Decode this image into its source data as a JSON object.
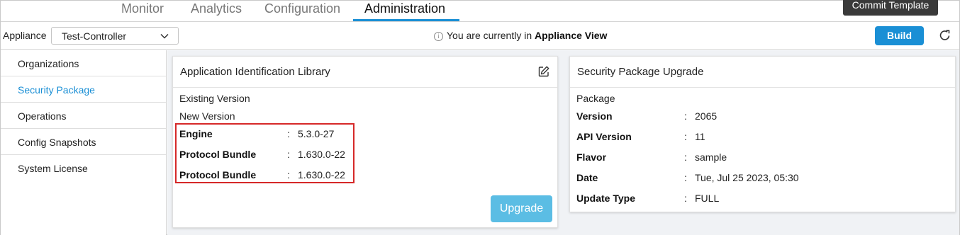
{
  "nav": {
    "tabs": [
      {
        "label": "Monitor"
      },
      {
        "label": "Analytics"
      },
      {
        "label": "Configuration"
      },
      {
        "label": "Administration"
      }
    ],
    "commit_label": "Commit Template"
  },
  "appliance_bar": {
    "label": "Appliance",
    "selected": "Test-Controller",
    "info_prefix": "You are currently in",
    "info_view": "Appliance View",
    "build_label": "Build"
  },
  "sidebar": {
    "items": [
      {
        "label": "Organizations"
      },
      {
        "label": "Security Package"
      },
      {
        "label": "Operations"
      },
      {
        "label": "Config Snapshots"
      },
      {
        "label": "System License"
      }
    ]
  },
  "app_id_card": {
    "title": "Application Identification Library",
    "existing_version_label": "Existing Version",
    "new_version_label": "New Version",
    "rows": [
      {
        "label": "Engine",
        "colon": ":",
        "value": "5.3.0-27"
      },
      {
        "label": "Protocol Bundle",
        "colon": ":",
        "value": "1.630.0-22"
      },
      {
        "label": "Protocol Bundle",
        "colon": ":",
        "value": "1.630.0-22"
      }
    ],
    "upgrade_label": "Upgrade"
  },
  "security_card": {
    "title": "Security Package Upgrade",
    "package_label": "Package",
    "rows": [
      {
        "label": "Version",
        "colon": ":",
        "value": "2065"
      },
      {
        "label": "API Version",
        "colon": ":",
        "value": "11"
      },
      {
        "label": "Flavor",
        "colon": ":",
        "value": "sample"
      },
      {
        "label": "Date",
        "colon": ":",
        "value": "Tue, Jul 25 2023, 05:30"
      },
      {
        "label": "Update Type",
        "colon": ":",
        "value": "FULL"
      }
    ]
  },
  "colors": {
    "accent": "#1a8fd5",
    "highlight": "#d62828",
    "upgrade_disabled": "#5bbde4"
  }
}
